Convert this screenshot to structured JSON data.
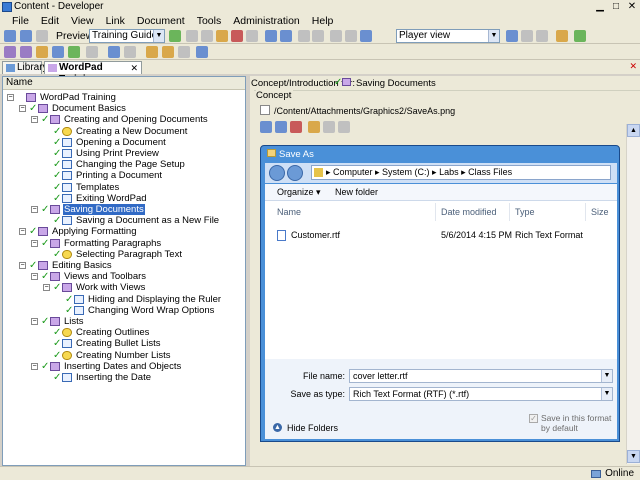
{
  "window": {
    "title": "Content - Developer"
  },
  "menu": [
    "File",
    "Edit",
    "View",
    "Link",
    "Document",
    "Tools",
    "Administration",
    "Help"
  ],
  "toolbar": {
    "preview_label": "Preview:",
    "preview_value": "Training Guide",
    "player_value": "Player view"
  },
  "tabs": [
    {
      "label": "Library"
    },
    {
      "label": "WordPad Training"
    }
  ],
  "tree": {
    "header": "Name",
    "nodes": [
      {
        "label": "WordPad Training",
        "depth": 0,
        "icon": "book-icon",
        "tog": "−",
        "checked": false
      },
      {
        "label": "Document Basics",
        "depth": 1,
        "icon": "book-icon",
        "tog": "−",
        "checked": true
      },
      {
        "label": "Creating and Opening Documents",
        "depth": 2,
        "icon": "book-icon",
        "tog": "−",
        "checked": true
      },
      {
        "label": "Creating a New Document",
        "depth": 3,
        "icon": "bulb-icon",
        "tog": "",
        "checked": true
      },
      {
        "label": "Opening a Document",
        "depth": 3,
        "icon": "page-icon",
        "tog": "",
        "checked": true
      },
      {
        "label": "Using Print Preview",
        "depth": 3,
        "icon": "page-icon",
        "tog": "",
        "checked": true
      },
      {
        "label": "Changing the Page Setup",
        "depth": 3,
        "icon": "page-icon",
        "tog": "",
        "checked": true
      },
      {
        "label": "Printing a Document",
        "depth": 3,
        "icon": "page-icon",
        "tog": "",
        "checked": true
      },
      {
        "label": "Templates",
        "depth": 3,
        "icon": "page-icon",
        "tog": "",
        "checked": true
      },
      {
        "label": "Exiting WordPad",
        "depth": 3,
        "icon": "page-icon",
        "tog": "",
        "checked": true
      },
      {
        "label": "Saving Documents",
        "depth": 2,
        "icon": "book-icon",
        "tog": "−",
        "checked": true,
        "selected": true
      },
      {
        "label": "Saving a Document as a New File",
        "depth": 3,
        "icon": "page-icon",
        "tog": "",
        "checked": true
      },
      {
        "label": "Applying Formatting",
        "depth": 1,
        "icon": "book-icon",
        "tog": "−",
        "checked": true
      },
      {
        "label": "Formatting Paragraphs",
        "depth": 2,
        "icon": "book-icon",
        "tog": "−",
        "checked": true
      },
      {
        "label": "Selecting Paragraph Text",
        "depth": 3,
        "icon": "bulb-icon",
        "tog": "",
        "checked": true
      },
      {
        "label": "Editing Basics",
        "depth": 1,
        "icon": "book-icon",
        "tog": "−",
        "checked": true
      },
      {
        "label": "Views and Toolbars",
        "depth": 2,
        "icon": "book-icon",
        "tog": "−",
        "checked": true
      },
      {
        "label": "Work with Views",
        "depth": 3,
        "icon": "book-icon",
        "tog": "−",
        "checked": true
      },
      {
        "label": "Hiding and Displaying the Ruler",
        "depth": 4,
        "icon": "page-icon",
        "tog": "",
        "checked": true
      },
      {
        "label": "Changing Word Wrap Options",
        "depth": 4,
        "icon": "page-icon",
        "tog": "",
        "checked": true
      },
      {
        "label": "Lists",
        "depth": 2,
        "icon": "book-icon",
        "tog": "−",
        "checked": true
      },
      {
        "label": "Creating Outlines",
        "depth": 3,
        "icon": "bulb-icon",
        "tog": "",
        "checked": true
      },
      {
        "label": "Creating Bullet Lists",
        "depth": 3,
        "icon": "page-icon",
        "tog": "",
        "checked": true
      },
      {
        "label": "Creating Number Lists",
        "depth": 3,
        "icon": "bulb-icon",
        "tog": "",
        "checked": true
      },
      {
        "label": "Inserting Dates and Objects",
        "depth": 2,
        "icon": "book-icon",
        "tog": "−",
        "checked": true
      },
      {
        "label": "Inserting the Date",
        "depth": 3,
        "icon": "page-icon",
        "tog": "",
        "checked": true
      }
    ]
  },
  "right": {
    "concept_for_label": "Concept/Introduction for:",
    "concept_for_value": "Saving Documents",
    "concept_group_label": "Concept",
    "concept_path": "/Content/Attachments/Graphics2/SaveAs.png"
  },
  "dialog": {
    "title": "Save As",
    "breadcrumb": "▸ Computer ▸ System (C:) ▸ Labs ▸ Class Files",
    "organize": "Organize ▾",
    "new_folder": "New folder",
    "columns": [
      "Name",
      "Date modified",
      "Type",
      "Size"
    ],
    "files": [
      {
        "name": "Customer.rtf",
        "date": "5/6/2014 4:15 PM",
        "type": "Rich Text Format"
      }
    ],
    "file_name_label": "File name:",
    "file_name_value": "cover letter.rtf",
    "save_type_label": "Save as type:",
    "save_type_value": "Rich Text Format (RTF) (*.rtf)",
    "hide_folders": "Hide Folders",
    "default_format_label": "Save in this format by default"
  },
  "status": {
    "online": "Online"
  },
  "colors": {
    "accent": "#316ac5",
    "check": "#1c9a1c",
    "dialog_frame": "#4a90d8"
  }
}
